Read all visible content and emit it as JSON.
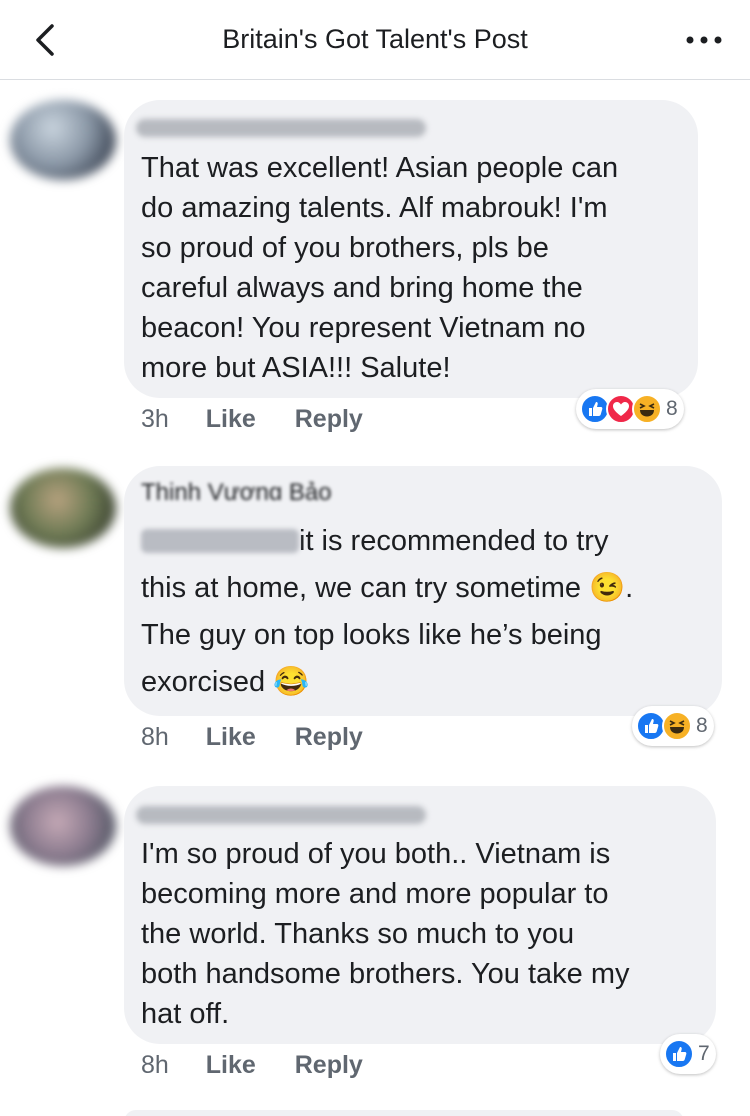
{
  "header": {
    "title": "Britain's Got Talent's Post"
  },
  "comments": [
    {
      "lines": [
        "That was excellent! Asian people can",
        "do amazing talents. Alf mabrouk! I'm",
        "so proud of you brothers, pls be",
        "careful always and bring home the",
        "beacon! You represent Vietnam no",
        "more but ASIA!!! Salute!"
      ],
      "time": "3h",
      "like_label": "Like",
      "reply_label": "Reply",
      "reactions": [
        "like",
        "love",
        "haha"
      ],
      "reaction_count": "8"
    },
    {
      "author_partial": "Thịnh Vương Bảo",
      "lines": [
        "it is recommended to try",
        "this at home, we can try sometime",
        "The guy on top looks like he’s being",
        "exorcised"
      ],
      "emoji_wink": "😉",
      "emoji_laugh": "😂",
      "time": "8h",
      "like_label": "Like",
      "reply_label": "Reply",
      "reactions": [
        "like",
        "haha"
      ],
      "reaction_count": "8"
    },
    {
      "lines": [
        "I'm so proud of you both.. Vietnam is",
        "becoming more and more popular to",
        "the world. Thanks so much to you",
        "both handsome brothers. You take my",
        "hat off."
      ],
      "time": "8h",
      "like_label": "Like",
      "reply_label": "Reply",
      "reactions": [
        "like"
      ],
      "reaction_count": "7"
    }
  ],
  "colors": {
    "bubble": "#f0f1f4",
    "like_blue": "#1877f2",
    "love_red": "#f02849",
    "haha_yellow": "#f7b125",
    "meta_gray": "#606770"
  }
}
